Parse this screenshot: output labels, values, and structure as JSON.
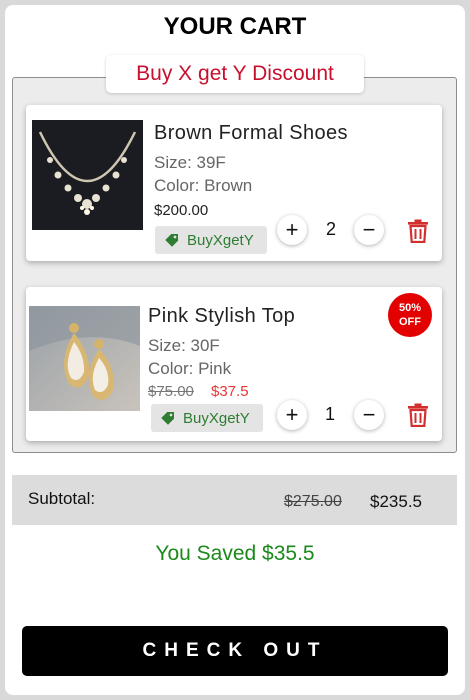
{
  "title": "YOUR CART",
  "discount_group": {
    "label": "Buy X get Y Discount",
    "items": [
      {
        "name": "Brown Formal Shoes",
        "size": "Size: 39F",
        "color": "Color: Brown",
        "price": "$200.00",
        "tag": "BuyXgetY",
        "quantity": "2",
        "plus": "+",
        "minus": "−"
      },
      {
        "name": "Pink Stylish Top",
        "size": "Size: 30F",
        "color": "Color: Pink",
        "original_price": "$75.00",
        "sale_price": "$37.5",
        "badge_line1": "50%",
        "badge_line2": "OFF",
        "tag": "BuyXgetY",
        "quantity": "1",
        "plus": "+",
        "minus": "−"
      }
    ]
  },
  "summary": {
    "subtotal_label": "Subtotal:",
    "subtotal_original": "$275.00",
    "subtotal_final": "$235.5",
    "saved_text": "You Saved $35.5"
  },
  "checkout_label": "CHECK OUT",
  "icons": {
    "tag": "price-tag-icon",
    "trash": "trash-icon"
  },
  "colors": {
    "discount_label": "#c8102e",
    "tag_text": "#2e7d32",
    "sale_price": "#e53935",
    "badge": "#e30000",
    "trash": "#d32f2f",
    "saved_text": "#1b8a1b",
    "checkout_bg": "#000000"
  }
}
